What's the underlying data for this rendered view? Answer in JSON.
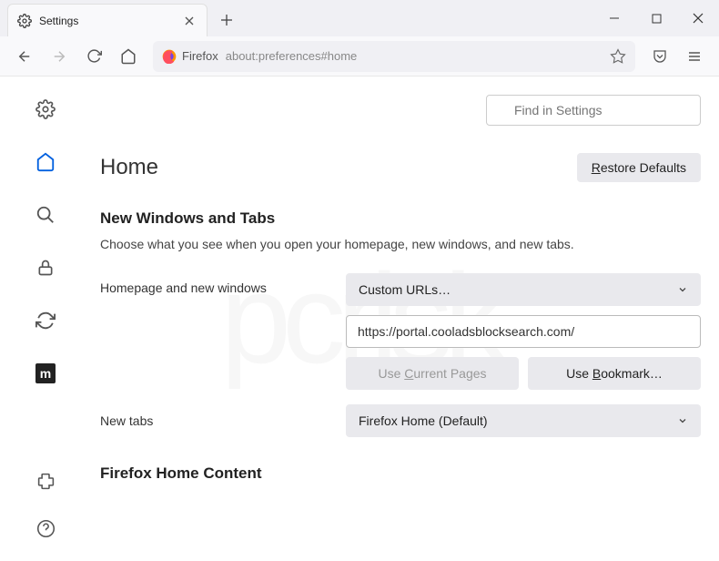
{
  "tab": {
    "title": "Settings"
  },
  "urlbar": {
    "identity": "Firefox",
    "url": "about:preferences#home"
  },
  "search": {
    "placeholder": "Find in Settings"
  },
  "page": {
    "title": "Home",
    "restore": "Restore Defaults"
  },
  "section1": {
    "title": "New Windows and Tabs",
    "desc": "Choose what you see when you open your homepage, new windows, and new tabs."
  },
  "homepage": {
    "label": "Homepage and new windows",
    "selectValue": "Custom URLs…",
    "url": "https://portal.cooladsblocksearch.com/",
    "useCurrent": "Use Current Pages",
    "useBookmark": "Use Bookmark…"
  },
  "newtabs": {
    "label": "New tabs",
    "selectValue": "Firefox Home (Default)"
  },
  "section2": {
    "title": "Firefox Home Content"
  }
}
